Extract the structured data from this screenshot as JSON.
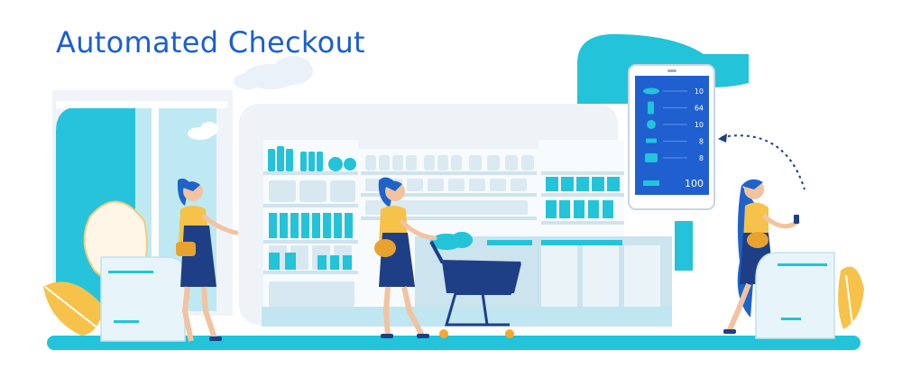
{
  "title": "Automated Checkout",
  "tablet": {
    "items": [
      {
        "icon": "bottle-icon",
        "count": "10"
      },
      {
        "icon": "tall-bottle-icon",
        "count": "64"
      },
      {
        "icon": "fruit-icon",
        "count": "10"
      },
      {
        "icon": "cup-icon",
        "count": "8"
      },
      {
        "icon": "jar-icon",
        "count": "8"
      }
    ],
    "total": "100"
  },
  "colors": {
    "title_blue": "#1a5fd0",
    "accent_cyan": "#23c3d9",
    "light_blue": "#cdeef5",
    "tablet_screen": "#1f5fd0",
    "hair_blue": "#1e63c9",
    "skin": "#f2c3a0",
    "leaf_yellow": "#f6c24a"
  }
}
